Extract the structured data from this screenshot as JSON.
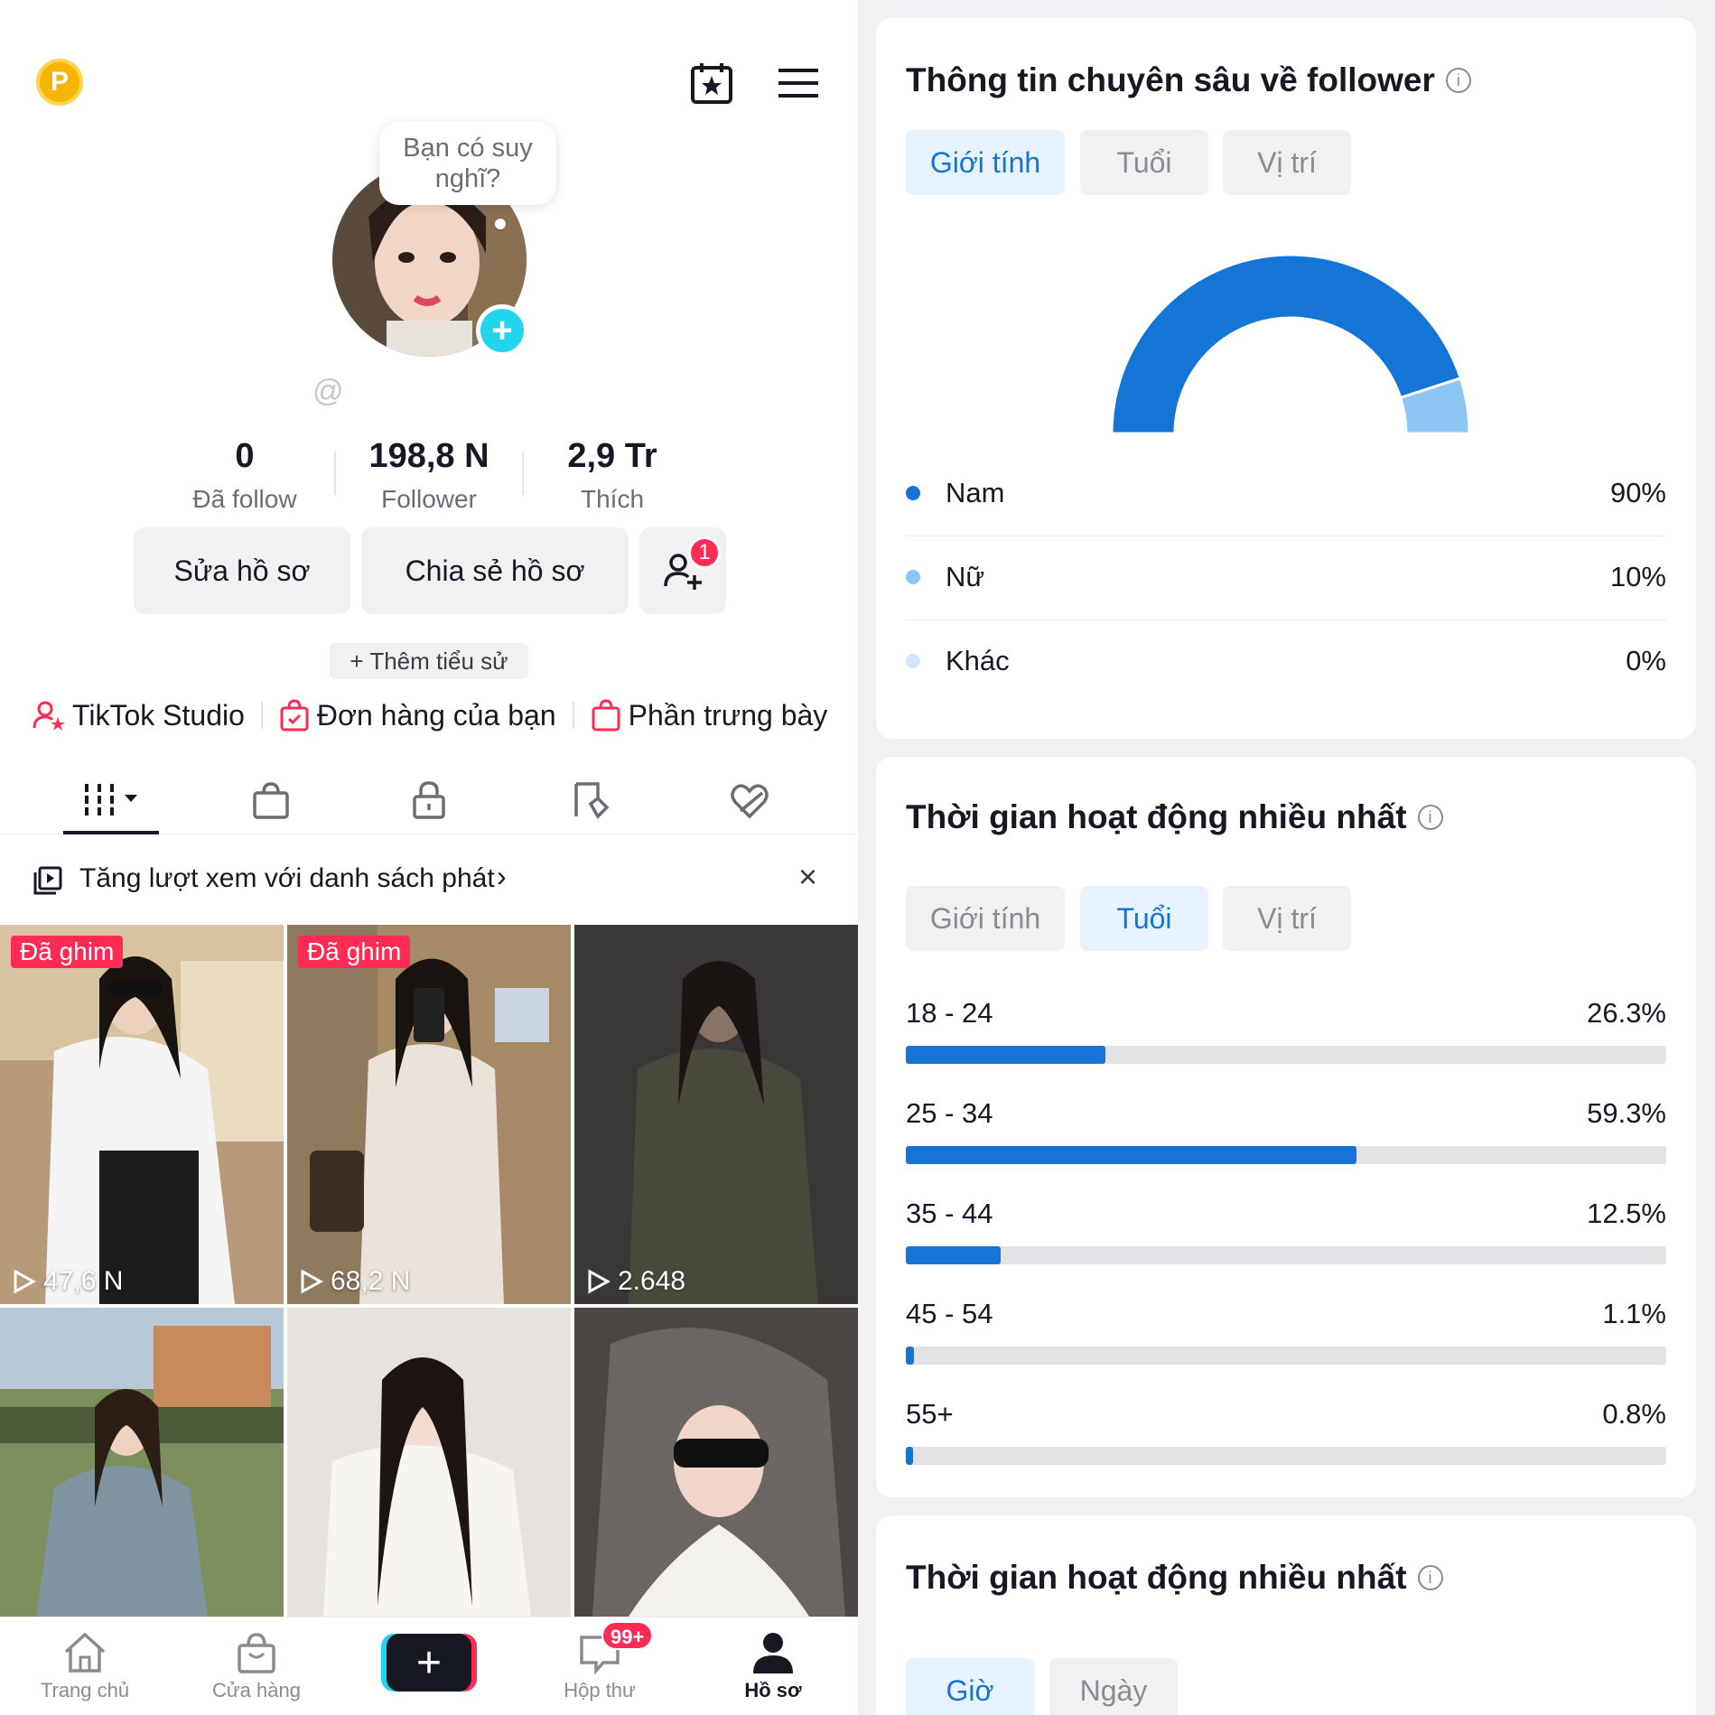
{
  "profile": {
    "bubble_text": "Bạn có suy nghĩ?",
    "handle_prefix": "@",
    "stats": [
      {
        "value": "0",
        "label": "Đã follow"
      },
      {
        "value": "198,8 N",
        "label": "Follower"
      },
      {
        "value": "2,9 Tr",
        "label": "Thích"
      }
    ],
    "edit_button": "Sửa hồ sơ",
    "share_button": "Chia sẻ hồ sơ",
    "add_friend_badge": "1",
    "add_bio": "+ Thêm tiểu sử",
    "links": [
      "TikTok Studio",
      "Đơn hàng của bạn",
      "Phần trưng bày"
    ],
    "promo": "Tăng lượt xem với danh sách phát",
    "promo_close": "×",
    "videos": [
      {
        "pinned_label": "Đã ghim",
        "views": "47,6 N"
      },
      {
        "pinned_label": "Đã ghim",
        "views": "68,2 N"
      },
      {
        "pinned_label": "",
        "views": "2.648"
      },
      {
        "pinned_label": "",
        "views": ""
      },
      {
        "pinned_label": "",
        "views": ""
      },
      {
        "pinned_label": "",
        "views": ""
      }
    ]
  },
  "nav": {
    "items": [
      "Trang chủ",
      "Cửa hàng",
      "",
      "Hộp thư",
      "Hồ sơ"
    ],
    "inbox_badge": "99+",
    "add_symbol": "+",
    "active_index": 4
  },
  "icons": {
    "badge": "P",
    "top": [
      "calendar-star-icon",
      "menu-icon"
    ],
    "tabs": [
      "grid-icon",
      "shop-bag-icon",
      "lock-icon",
      "tag-icon",
      "heart-icon"
    ]
  },
  "colors": {
    "accent": "#1575d6",
    "light_accent": "#8cc4f2",
    "pale_accent": "#cfe6fb",
    "brand_red": "#fe2c55",
    "brand_cyan": "#20d5ec"
  },
  "insights": {
    "gender_card": {
      "title": "Thông tin chuyên sâu về follower",
      "tabs": [
        "Giới tính",
        "Tuổi",
        "Vị trí"
      ],
      "active_tab": 0
    },
    "age_card": {
      "title": "Thời gian hoạt động nhiều nhất",
      "tabs": [
        "Giới tính",
        "Tuổi",
        "Vị trí"
      ],
      "active_tab": 1
    },
    "time_card": {
      "title": "Thời gian hoạt động nhiều nhất",
      "tabs": [
        "Giờ",
        "Ngày"
      ],
      "active_tab": 0
    }
  },
  "chart_data": [
    {
      "type": "pie",
      "style": "half-donut",
      "categories": [
        "Nam",
        "Nữ",
        "Khác"
      ],
      "values": [
        90,
        10,
        0
      ],
      "value_labels": [
        "90%",
        "10%",
        "0%"
      ],
      "unit": "%"
    },
    {
      "type": "bar",
      "orientation": "horizontal",
      "categories": [
        "18 - 24",
        "25 - 34",
        "35 - 44",
        "45 - 54",
        "55+"
      ],
      "values": [
        26.3,
        59.3,
        12.5,
        1.1,
        0.8
      ],
      "value_labels": [
        "26.3%",
        "59.3%",
        "12.5%",
        "1.1%",
        "0.8%"
      ],
      "xlim": [
        0,
        100
      ],
      "unit": "%"
    }
  ]
}
